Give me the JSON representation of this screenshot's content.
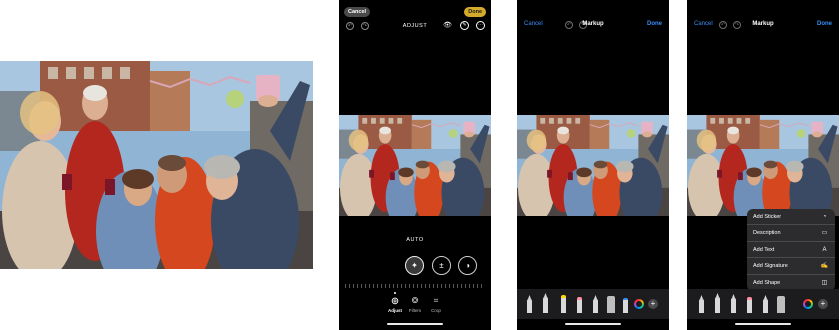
{
  "edit_screen": {
    "cancel_label": "Cancel",
    "done_label": "Done",
    "mode_title": "ADJUST",
    "auto_label": "AUTO",
    "tabs": [
      {
        "label": "Adjust",
        "icon": "adjust-dial-icon",
        "active": true
      },
      {
        "label": "Filters",
        "icon": "filters-icon",
        "active": false
      },
      {
        "label": "Crop",
        "icon": "crop-icon",
        "active": false
      }
    ],
    "tools": [
      {
        "icon": "magic-wand-icon",
        "active": true
      },
      {
        "icon": "exposure-icon",
        "active": false
      },
      {
        "icon": "brilliance-icon",
        "active": false
      }
    ]
  },
  "markup_screen": {
    "cancel_label": "Cancel",
    "title": "Markup",
    "done_label": "Done"
  },
  "markup_menu": {
    "items": [
      {
        "label": "Add Sticker",
        "icon": "sticker-icon"
      },
      {
        "label": "Description",
        "icon": "description-icon"
      },
      {
        "label": "Add Text",
        "icon": "text-box-icon"
      },
      {
        "label": "Add Signature",
        "icon": "signature-icon"
      },
      {
        "label": "Add Shape",
        "icon": "shape-icon"
      }
    ]
  },
  "colors": {
    "accent_blue": "#3a8ef6",
    "done_yellow": "#d4aa2b",
    "phone_bg": "#000000",
    "toolbar_bg": "#1c1c1e",
    "menu_bg": "#2c2c2e"
  }
}
